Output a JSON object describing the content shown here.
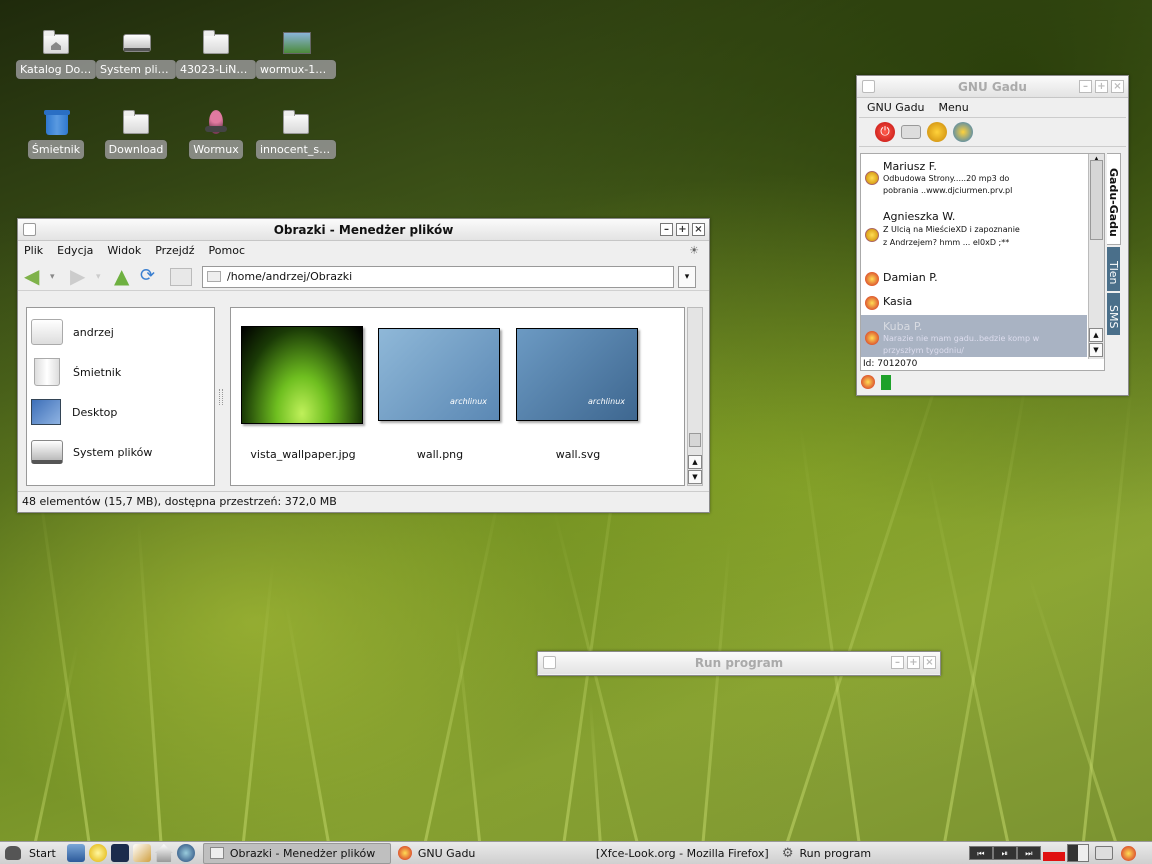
{
  "desktop_icons": [
    {
      "label": "Katalog Dom...",
      "icon": "home-folder-icon"
    },
    {
      "label": "System plików",
      "icon": "drive-icon"
    },
    {
      "label": "43023-LiNsta...",
      "icon": "folder-icon"
    },
    {
      "label": "wormux-128...",
      "icon": "image-file-icon"
    },
    {
      "label": "Śmietnik",
      "icon": "trash-icon"
    },
    {
      "label": "Download",
      "icon": "folder-icon"
    },
    {
      "label": "Wormux",
      "icon": "wormux-icon"
    },
    {
      "label": "innocent_stuf...",
      "icon": "folder-icon"
    }
  ],
  "file_manager": {
    "title": "Obrazki - Menedżer plików",
    "menu": [
      "Plik",
      "Edycja",
      "Widok",
      "Przejdź",
      "Pomoc"
    ],
    "path": "/home/andrzej/Obrazki",
    "sidebar": [
      {
        "label": "andrzej",
        "icon": "home-folder-icon"
      },
      {
        "label": "Śmietnik",
        "icon": "trash-icon"
      },
      {
        "label": "Desktop",
        "icon": "desktop-icon"
      },
      {
        "label": "System plików",
        "icon": "drive-icon"
      }
    ],
    "files": [
      {
        "name": "vista_wallpaper.jpg",
        "thumb": "grass"
      },
      {
        "name": "wall.png",
        "thumb": "archlinux"
      },
      {
        "name": "wall.svg",
        "thumb": "archlinux"
      }
    ],
    "thumb_logo": "archlinux",
    "status": "48 elementów (15,7 MB), dostępna przestrzeń: 372,0 MB"
  },
  "gnu_gadu": {
    "title": "GNU Gadu",
    "menu": [
      "GNU Gadu",
      "Menu"
    ],
    "contacts": [
      {
        "name": "Mariusz F.",
        "desc": "Odbudowa Strony.....20 mp3 do pobrania ..www.djciurmen.prv.pl",
        "status": "online-desc"
      },
      {
        "name": "Agnieszka W.",
        "desc": "Z Ulcią na MieścieXD i zapoznanie z Andrzejem? hmm ... el0xD ;**",
        "status": "online-desc"
      },
      {
        "name": "Damian P.",
        "desc": "",
        "status": "online"
      },
      {
        "name": "Kasia",
        "desc": "",
        "status": "online"
      },
      {
        "name": "Kuba P.",
        "desc": "Narazie nie mam gadu..bedzie komp w przyszłym tygodniu/",
        "status": "busy-desc"
      }
    ],
    "side_tabs": [
      "Gadu-Gadu",
      "Tlen",
      "SMS"
    ],
    "id_label": "Id: 7012070"
  },
  "run_program": {
    "title": "Run program"
  },
  "taskbar": {
    "start": "Start",
    "tasks": [
      {
        "label": "Obrazki - Menedżer plików",
        "active": true
      },
      {
        "label": "GNU Gadu",
        "active": false
      },
      {
        "label": "[Xfce-Look.org - Mozilla Firefox]",
        "active": false
      },
      {
        "label": "Run program",
        "active": false
      }
    ]
  }
}
